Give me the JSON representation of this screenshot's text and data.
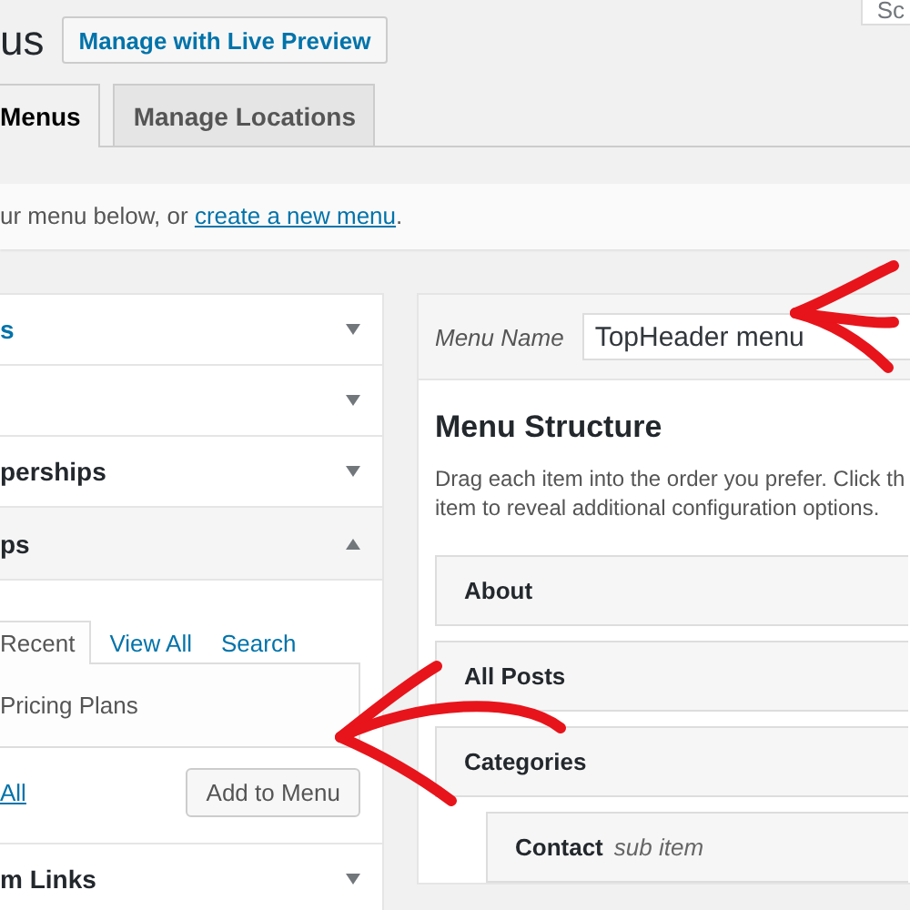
{
  "header": {
    "title": "us",
    "live_preview_button": "Manage with Live Preview",
    "screen_options": "Sc"
  },
  "tabs": [
    {
      "label": "Menus",
      "selected": true
    },
    {
      "label": "Manage Locations",
      "selected": false
    }
  ],
  "notice": {
    "text": "ur menu below, or ",
    "link": "create a new menu",
    "after": "."
  },
  "sections": [
    {
      "title": "s",
      "expanded": false,
      "hovered": true
    },
    {
      "expanded": false
    },
    {
      "title": "perships",
      "expanded": false,
      "hovered": false
    },
    {
      "title": "ps",
      "expanded": true,
      "hovered": false,
      "tabs": [
        {
          "label": "Recent",
          "selected": true
        },
        {
          "label": "View All",
          "selected": false
        },
        {
          "label": "Search",
          "selected": false
        }
      ],
      "items": [
        "Pricing Plans"
      ],
      "select_all": "All",
      "add_button": "Add to Menu"
    },
    {
      "title": "m Links",
      "expanded": false,
      "hovered": false
    }
  ],
  "editor": {
    "name_label": "Menu Name",
    "name_value": "TopHeader menu",
    "heading": "Menu Structure",
    "description_lines": [
      "Drag each item into the order you prefer. Click th",
      "item to reveal additional configuration options."
    ],
    "items": [
      {
        "title": "About"
      },
      {
        "title": "All Posts"
      },
      {
        "title": "Categories",
        "children": [
          {
            "title": "Contact",
            "sub_label": "sub item"
          }
        ]
      }
    ]
  }
}
